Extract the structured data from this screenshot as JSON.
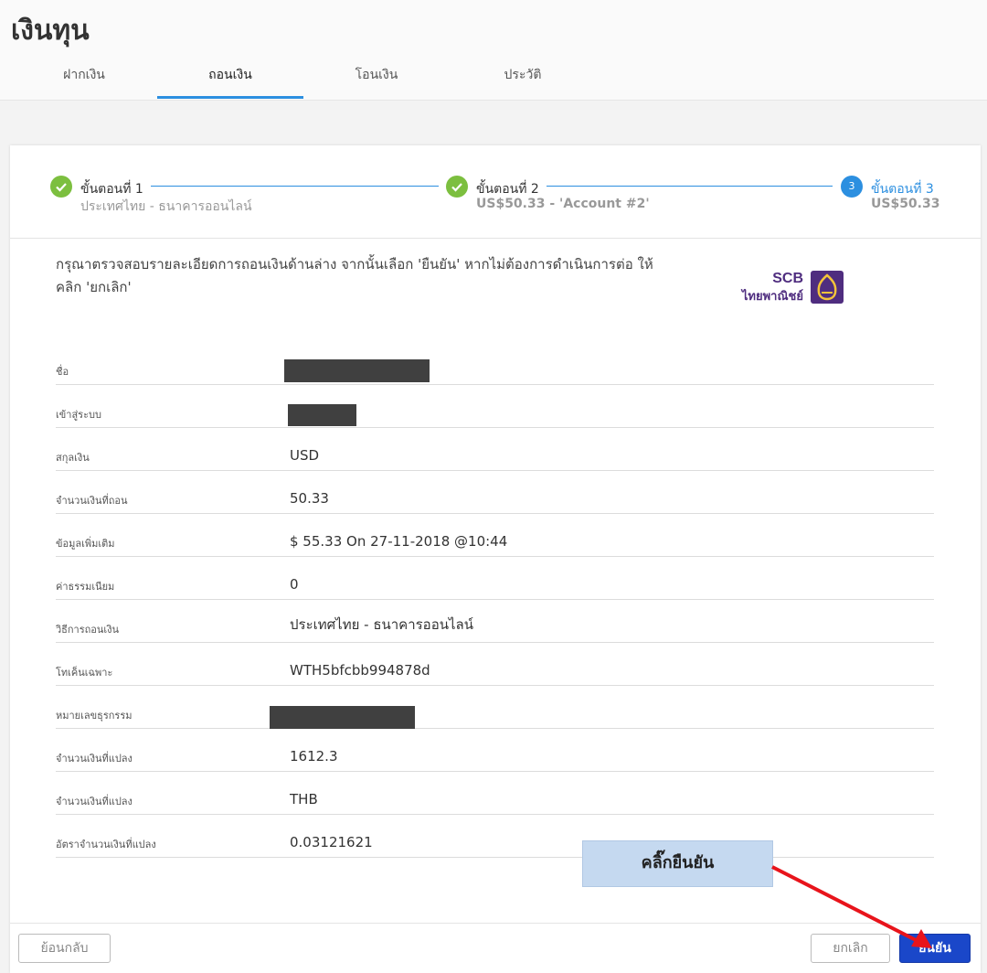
{
  "page": {
    "title": "เงินทุน"
  },
  "tabs": [
    {
      "label": "ฝากเงิน"
    },
    {
      "label": "ถอนเงิน"
    },
    {
      "label": "โอนเงิน"
    },
    {
      "label": "ประวัติ"
    }
  ],
  "stepper": {
    "steps": [
      {
        "number": "1",
        "title": "ขั้นตอนที่ 1",
        "subtitle": "ประเทศไทย - ธนาคารออนไลน์"
      },
      {
        "number": "2",
        "title": "ขั้นตอนที่ 2",
        "subtitle": "US$50.33 - 'Account #2'"
      },
      {
        "number": "3",
        "title": "ขั้นตอนที่ 3",
        "subtitle": "US$50.33"
      }
    ]
  },
  "instructions": "กรุณาตรวจสอบรายละเอียดการถอนเงินด้านล่าง จากนั้นเลือก 'ยืนยัน' หากไม่ต้องการดำเนินการต่อ ให้คลิก 'ยกเลิก'",
  "logo": {
    "brand": "SCB",
    "name_th": "ไทยพาณิชย์"
  },
  "details": [
    {
      "label": "ชื่อ",
      "value": ""
    },
    {
      "label": "เข้าสู่ระบบ",
      "value": ""
    },
    {
      "label": "สกุลเงิน",
      "value": "USD"
    },
    {
      "label": "จำนวนเงินที่ถอน",
      "value": "50.33"
    },
    {
      "label": "ข้อมูลเพิ่มเติม",
      "value": "$ 55.33 On 27-11-2018 @10:44"
    },
    {
      "label": "ค่าธรรมเนียม",
      "value": "0"
    },
    {
      "label": "วิธีการถอนเงิน",
      "value": "ประเทศไทย - ธนาคารออนไลน์"
    },
    {
      "label": "โทเค็นเฉพาะ",
      "value": "WTH5bfcbb994878d"
    },
    {
      "label": "หมายเลขธุรกรรม",
      "value": ""
    },
    {
      "label": "จำนวนเงินที่แปลง",
      "value": "1612.3"
    },
    {
      "label": "จำนวนเงินที่แปลง",
      "value": "THB"
    },
    {
      "label": "อัตราจำนวนเงินที่แปลง",
      "value": "0.03121621"
    }
  ],
  "footer": {
    "back_label": "ย้อนกลับ",
    "cancel_label": "ยกเลิก",
    "confirm_label": "ยืนยัน"
  },
  "callout": {
    "text": "คลิ๊กยืนยัน"
  },
  "colors": {
    "accent": "#2c8fe0",
    "done": "#7cbf3f",
    "primary_button": "#1a47c9",
    "brand": "#4f2d7f",
    "arrow": "#e8141b"
  }
}
